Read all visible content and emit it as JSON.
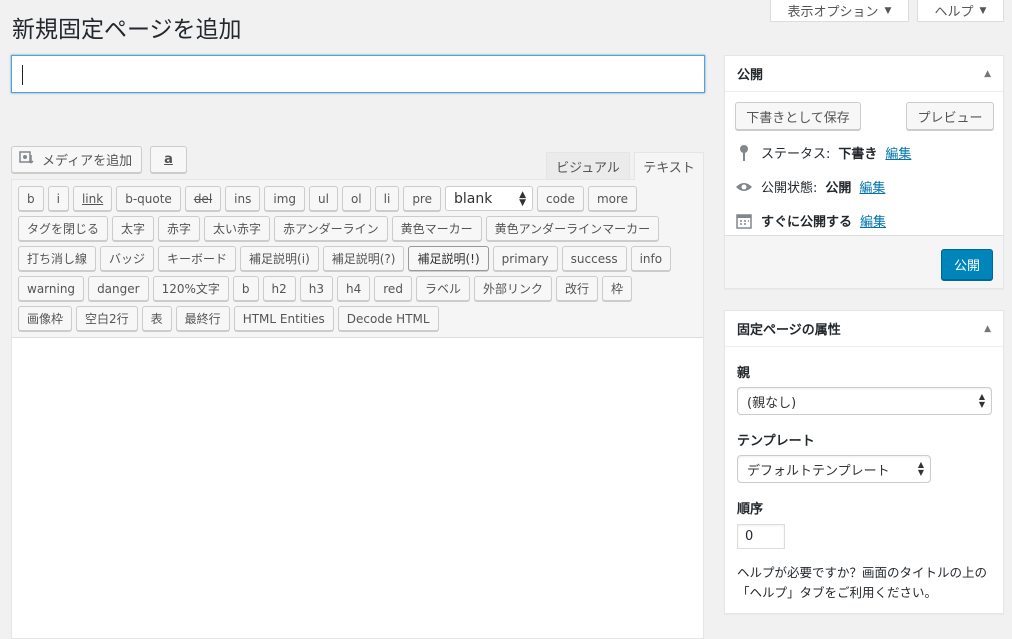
{
  "header": {
    "title": "新規固定ページを追加",
    "screen_options_label": "表示オプション",
    "help_label": "ヘルプ"
  },
  "title_input": {
    "value": ""
  },
  "media": {
    "add_media_label": "メディアを追加",
    "amazon_label": "a"
  },
  "editor_tabs": {
    "visual": "ビジュアル",
    "text": "テキスト"
  },
  "quicktags": {
    "row1": [
      "b",
      "i",
      "link",
      "b-quote",
      "del",
      "ins",
      "img",
      "ul",
      "ol",
      "li",
      "pre"
    ],
    "select_value": "blank",
    "row1_after": [
      "code",
      "more"
    ],
    "row2": [
      "タグを閉じる",
      "太字",
      "赤字",
      "太い赤字",
      "赤アンダーライン",
      "黄色マーカー",
      "黄色アンダーラインマーカー"
    ],
    "row3": [
      "打ち消し線",
      "バッジ",
      "キーボード",
      "補足説明(i)",
      "補足説明(?)",
      "補足説明(!)",
      "primary",
      "success",
      "info"
    ],
    "row4": [
      "warning",
      "danger",
      "120%文字",
      "b",
      "h2",
      "h3",
      "h4",
      "red",
      "ラベル",
      "外部リンク",
      "改行",
      "枠"
    ],
    "row5": [
      "画像枠",
      "空白2行",
      "表",
      "最終行",
      "HTML Entities",
      "Decode HTML"
    ]
  },
  "publish_box": {
    "title": "公開",
    "save_draft": "下書きとして保存",
    "preview": "プレビュー",
    "status_label": "ステータス:",
    "status_value": "下書き",
    "visibility_label": "公開状態:",
    "visibility_value": "公開",
    "schedule_label": "すぐに公開する",
    "edit_link": "編集",
    "publish_button": "公開"
  },
  "attributes_box": {
    "title": "固定ページの属性",
    "parent_label": "親",
    "parent_value": "(親なし)",
    "template_label": "テンプレート",
    "template_value": "デフォルトテンプレート",
    "order_label": "順序",
    "order_value": "0",
    "help_text": "ヘルプが必要ですか？画面のタイトルの上の「ヘルプ」タブをご利用ください。"
  },
  "colors": {
    "primary": "#0085ba",
    "link": "#0073aa",
    "background": "#f1f1f1"
  }
}
